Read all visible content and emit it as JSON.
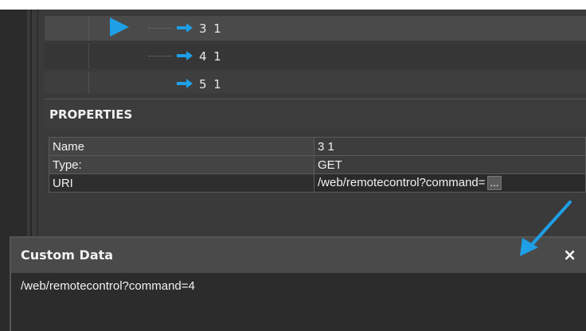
{
  "tree": {
    "items": [
      {
        "label": "3 1",
        "selected": true
      },
      {
        "label": "4 1",
        "selected": false
      },
      {
        "label": "5 1",
        "selected": false
      }
    ]
  },
  "properties": {
    "title": "PROPERTIES",
    "rows": [
      {
        "key": "Name",
        "value": "3 1"
      },
      {
        "key": "Type:",
        "value": "GET"
      },
      {
        "key": "URI",
        "value": "/web/remotecontrol?command=",
        "button": "..."
      }
    ]
  },
  "custom_data": {
    "title": "Custom Data",
    "close": "×",
    "text": "/web/remotecontrol?command=4"
  },
  "colors": {
    "accent": "#1e9fe6",
    "background": "#3a3a3a"
  },
  "icons": {
    "play": "play-icon",
    "arrow": "arrow-right-icon",
    "close": "close-icon"
  }
}
